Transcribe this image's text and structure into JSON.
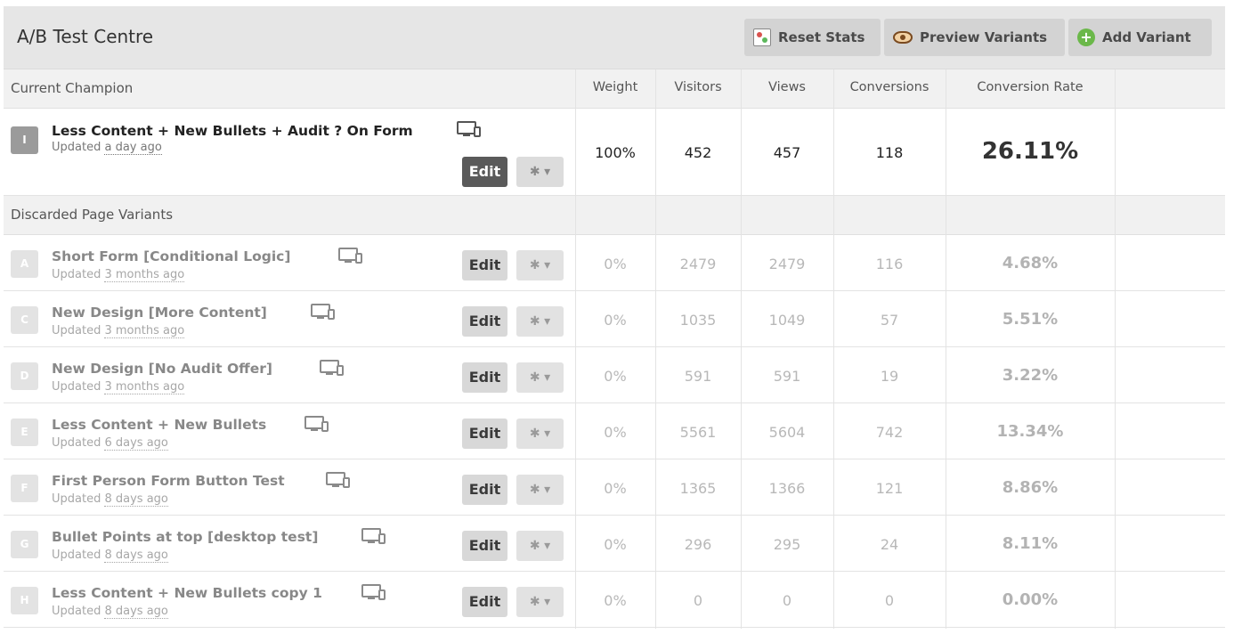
{
  "header": {
    "title": "A/B Test Centre",
    "reset_label": "Reset Stats",
    "preview_label": "Preview Variants",
    "add_label": "Add Variant"
  },
  "table": {
    "current_section": "Current Champion",
    "discarded_section": "Discarded Page Variants",
    "columns": [
      "Weight",
      "Visitors",
      "Views",
      "Conversions",
      "Conversion Rate"
    ]
  },
  "champion": {
    "badge": "I",
    "name": "Less Content + New Bullets + Audit ? On Form",
    "updated_prefix": "Updated",
    "updated": "a day ago",
    "edit": "Edit",
    "weight": "100%",
    "visitors": "452",
    "views": "457",
    "conversions": "118",
    "rate": "26.11%"
  },
  "discarded": [
    {
      "badge": "A",
      "name": "Short Form [Conditional Logic]",
      "updated_prefix": "Updated",
      "updated": "3 months ago",
      "edit": "Edit",
      "weight": "0%",
      "visitors": "2479",
      "views": "2479",
      "conversions": "116",
      "rate": "4.68%"
    },
    {
      "badge": "C",
      "name": "New Design [More Content]",
      "updated_prefix": "Updated",
      "updated": "3 months ago",
      "edit": "Edit",
      "weight": "0%",
      "visitors": "1035",
      "views": "1049",
      "conversions": "57",
      "rate": "5.51%"
    },
    {
      "badge": "D",
      "name": "New Design [No Audit Offer]",
      "updated_prefix": "Updated",
      "updated": "3 months ago",
      "edit": "Edit",
      "weight": "0%",
      "visitors": "591",
      "views": "591",
      "conversions": "19",
      "rate": "3.22%"
    },
    {
      "badge": "E",
      "name": "Less Content + New Bullets",
      "updated_prefix": "Updated",
      "updated": "6 days ago",
      "edit": "Edit",
      "weight": "0%",
      "visitors": "5561",
      "views": "5604",
      "conversions": "742",
      "rate": "13.34%"
    },
    {
      "badge": "F",
      "name": "First Person Form Button Test",
      "updated_prefix": "Updated",
      "updated": "8 days ago",
      "edit": "Edit",
      "weight": "0%",
      "visitors": "1365",
      "views": "1366",
      "conversions": "121",
      "rate": "8.86%"
    },
    {
      "badge": "G",
      "name": "Bullet Points at top [desktop test]",
      "updated_prefix": "Updated",
      "updated": "8 days ago",
      "edit": "Edit",
      "weight": "0%",
      "visitors": "296",
      "views": "295",
      "conversions": "24",
      "rate": "8.11%"
    },
    {
      "badge": "H",
      "name": "Less Content + New Bullets copy 1",
      "updated_prefix": "Updated",
      "updated": "8 days ago",
      "edit": "Edit",
      "weight": "0%",
      "visitors": "0",
      "views": "0",
      "conversions": "0",
      "rate": "0.00%"
    }
  ],
  "icons": {
    "device": "desktop-mobile-icon",
    "gear": "gear-icon",
    "reset": "reset-stats-icon",
    "preview": "eye-icon",
    "add": "plus-circle-icon"
  }
}
